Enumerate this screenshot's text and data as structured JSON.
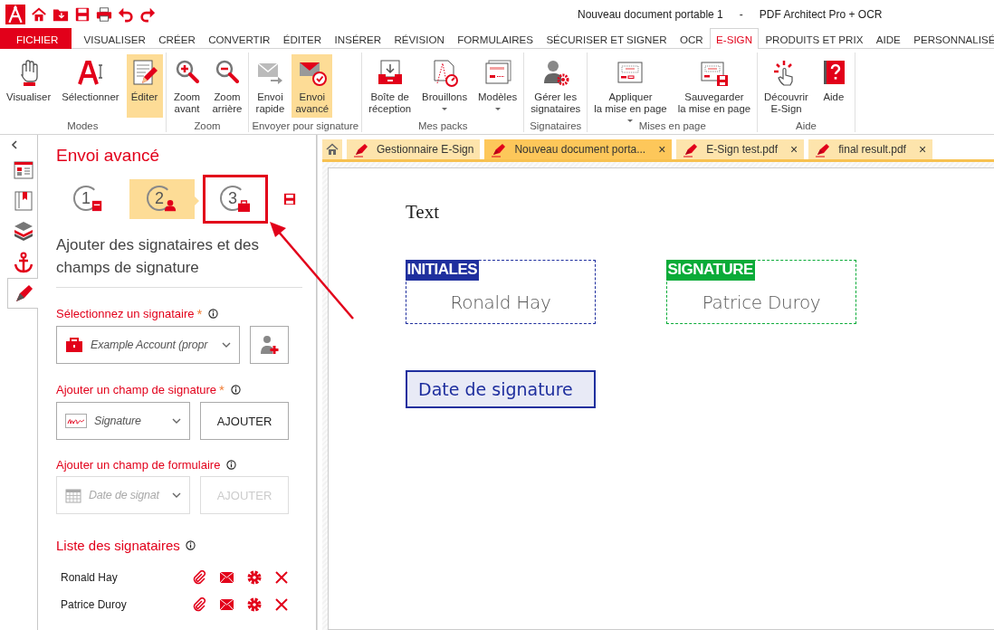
{
  "window": {
    "title": "Nouveau document portable 1",
    "separator": "-",
    "app_name": "PDF Architect Pro + OCR"
  },
  "quick_access": [
    {
      "kind": "logo"
    },
    {
      "kind": "home"
    },
    {
      "kind": "folder"
    },
    {
      "kind": "save"
    },
    {
      "kind": "print"
    },
    {
      "kind": "undo"
    },
    {
      "kind": "redo"
    }
  ],
  "menu_tabs": [
    {
      "label": "FICHIER",
      "kind": "file",
      "selected": false
    },
    {
      "label": "VISUALISER",
      "kind": "tab",
      "selected": false
    },
    {
      "label": "CRÉER",
      "kind": "tab",
      "selected": false
    },
    {
      "label": "CONVERTIR",
      "kind": "tab",
      "selected": false
    },
    {
      "label": "ÉDITER",
      "kind": "tab",
      "selected": false
    },
    {
      "label": "INSÉRER",
      "kind": "tab",
      "selected": false
    },
    {
      "label": "RÉVISION",
      "kind": "tab",
      "selected": false
    },
    {
      "label": "FORMULAIRES",
      "kind": "tab",
      "selected": false
    },
    {
      "label": "SÉCURISER ET SIGNER",
      "kind": "tab",
      "selected": false
    },
    {
      "label": "OCR",
      "kind": "tab",
      "selected": false
    },
    {
      "label": "E-SIGN",
      "kind": "tab",
      "selected": true
    },
    {
      "label": "PRODUITS ET PRIX",
      "kind": "tab",
      "selected": false
    },
    {
      "label": "AIDE",
      "kind": "tab",
      "selected": false
    },
    {
      "label": "PERSONNALISÉ",
      "kind": "tab",
      "selected": false
    }
  ],
  "ribbon_groups": [
    {
      "label": "Modes",
      "buttons": [
        {
          "label": "Visualiser",
          "kind": "hand",
          "selected": false,
          "dropdown": false
        },
        {
          "label": "Sélectionner",
          "kind": "select",
          "selected": false,
          "dropdown": false
        },
        {
          "label": "Éditer",
          "kind": "edit",
          "selected": true,
          "dropdown": false
        }
      ]
    },
    {
      "label": "Zoom",
      "buttons": [
        {
          "label": "Zoom\navant",
          "kind": "zoom-in",
          "selected": false,
          "dropdown": false
        },
        {
          "label": "Zoom\narrière",
          "kind": "zoom-out",
          "selected": false,
          "dropdown": false
        }
      ]
    },
    {
      "label": "Envoyer pour signature",
      "buttons": [
        {
          "label": "Envoi\nrapide",
          "kind": "quick-send",
          "selected": false,
          "dropdown": false
        },
        {
          "label": "Envoi\navancé",
          "kind": "advanced-send",
          "selected": true,
          "dropdown": false
        }
      ]
    },
    {
      "label": "Mes packs",
      "buttons": [
        {
          "label": "Boîte de\nréception",
          "kind": "inbox",
          "selected": false,
          "dropdown": false
        },
        {
          "label": "Brouillons",
          "kind": "drafts",
          "selected": false,
          "dropdown": true
        },
        {
          "label": "Modèles",
          "kind": "templates",
          "selected": false,
          "dropdown": true
        }
      ]
    },
    {
      "label": "Signataires",
      "buttons": [
        {
          "label": "Gérer les\nsignataires",
          "kind": "manage",
          "selected": false,
          "dropdown": false
        }
      ]
    },
    {
      "label": "Mises en page",
      "buttons": [
        {
          "label": "Appliquer\nla mise en page",
          "kind": "apply-layout",
          "selected": false,
          "dropdown": true
        },
        {
          "label": "Sauvegarder\nla mise en page",
          "kind": "save-layout",
          "selected": false,
          "dropdown": false
        }
      ]
    },
    {
      "label": "Aide",
      "buttons": [
        {
          "label": "Découvrir\nE-Sign",
          "kind": "discover",
          "selected": false,
          "dropdown": false
        },
        {
          "label": "Aide",
          "kind": "help",
          "selected": false,
          "dropdown": false
        }
      ]
    }
  ],
  "side_tabs": [
    {
      "kind": "pages",
      "selected": false
    },
    {
      "kind": "bookmarks",
      "selected": false
    },
    {
      "kind": "layers",
      "selected": false
    },
    {
      "kind": "anchor",
      "selected": false
    },
    {
      "kind": "esign",
      "selected": true
    }
  ],
  "panel": {
    "title": "Envoi avancé",
    "steps": [
      {
        "number": "1",
        "kind": "document",
        "selected": false,
        "highlighted": false
      },
      {
        "number": "2",
        "kind": "person",
        "selected": true,
        "highlighted": false
      },
      {
        "number": "3",
        "kind": "briefcase",
        "selected": false,
        "highlighted": true
      }
    ],
    "subtitle": "Ajouter des signataires et des champs de signature",
    "signer_select": {
      "label": "Sélectionnez un signataire",
      "required_mark": "*",
      "value": "Example Account (propr"
    },
    "signature_field": {
      "label": "Ajouter un champ de signature",
      "required_mark": "*",
      "value": "Signature",
      "button": "AJOUTER",
      "disabled": false
    },
    "form_field": {
      "label": "Ajouter un champ de formulaire",
      "value": "Date de signat",
      "button": "AJOUTER",
      "disabled": true
    },
    "signers_title": "Liste des signataires",
    "signers": [
      {
        "name": "Ronald Hay"
      },
      {
        "name": "Patrice Duroy"
      }
    ]
  },
  "doc_tabs": [
    {
      "kind": "home",
      "selected": false
    },
    {
      "kind": "file",
      "label": "Gestionnaire E-Sign",
      "selected": false
    },
    {
      "kind": "file",
      "label": "Nouveau document porta...",
      "close": "×",
      "selected": true
    },
    {
      "kind": "file",
      "label": "E-Sign test.pdf",
      "close": "×",
      "selected": false
    },
    {
      "kind": "file",
      "label": "final result.pdf",
      "close": "×",
      "selected": false
    }
  ],
  "document": {
    "text": "Text",
    "fields": [
      {
        "kind": "initials",
        "tag": "INITIALES",
        "name": "Ronald Hay",
        "color": "#1f2f9e"
      },
      {
        "kind": "signature",
        "tag": "SIGNATURE",
        "name": "Patrice Duroy",
        "color": "#0aab38"
      },
      {
        "kind": "date",
        "label": "Date de signature",
        "color": "#1f2f9e"
      }
    ]
  }
}
